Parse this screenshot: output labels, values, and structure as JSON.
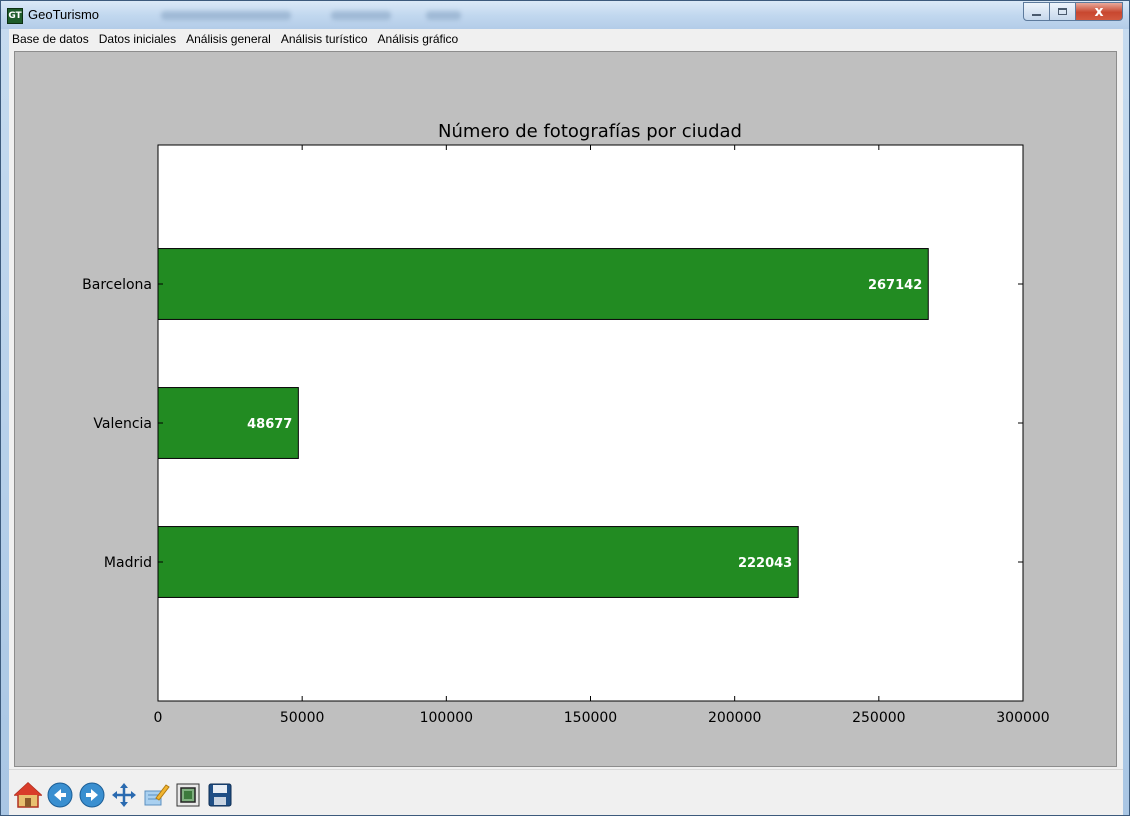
{
  "window": {
    "title": "GeoTurismo",
    "app_icon_text": "GT",
    "close_glyph": "x"
  },
  "menu": {
    "items": [
      "Base de datos",
      "Datos iniciales",
      "Análisis general",
      "Análisis turístico",
      "Análisis gráfico"
    ]
  },
  "toolbar": {
    "buttons": [
      "home-icon",
      "back-icon",
      "forward-icon",
      "pan-icon",
      "subplots-icon",
      "zoom-rect-icon",
      "save-icon"
    ]
  },
  "colors": {
    "bar": "#228b22",
    "figure_bg": "#bfbfbf",
    "axes_bg": "#ffffff"
  },
  "chart_data": {
    "type": "bar",
    "orientation": "horizontal",
    "title": "Número de fotografías por ciudad",
    "categories": [
      "Madrid",
      "Valencia",
      "Barcelona"
    ],
    "values": [
      222043,
      48677,
      267142
    ],
    "xlim": [
      0,
      300000
    ],
    "xticks": [
      0,
      50000,
      100000,
      150000,
      200000,
      250000,
      300000
    ],
    "xtick_labels": [
      "0",
      "50000",
      "100000",
      "150000",
      "200000",
      "250000",
      "300000"
    ],
    "data_labels": [
      "222043",
      "48677",
      "267142"
    ],
    "xlabel": "",
    "ylabel": "",
    "grid": false,
    "legend": "none"
  }
}
